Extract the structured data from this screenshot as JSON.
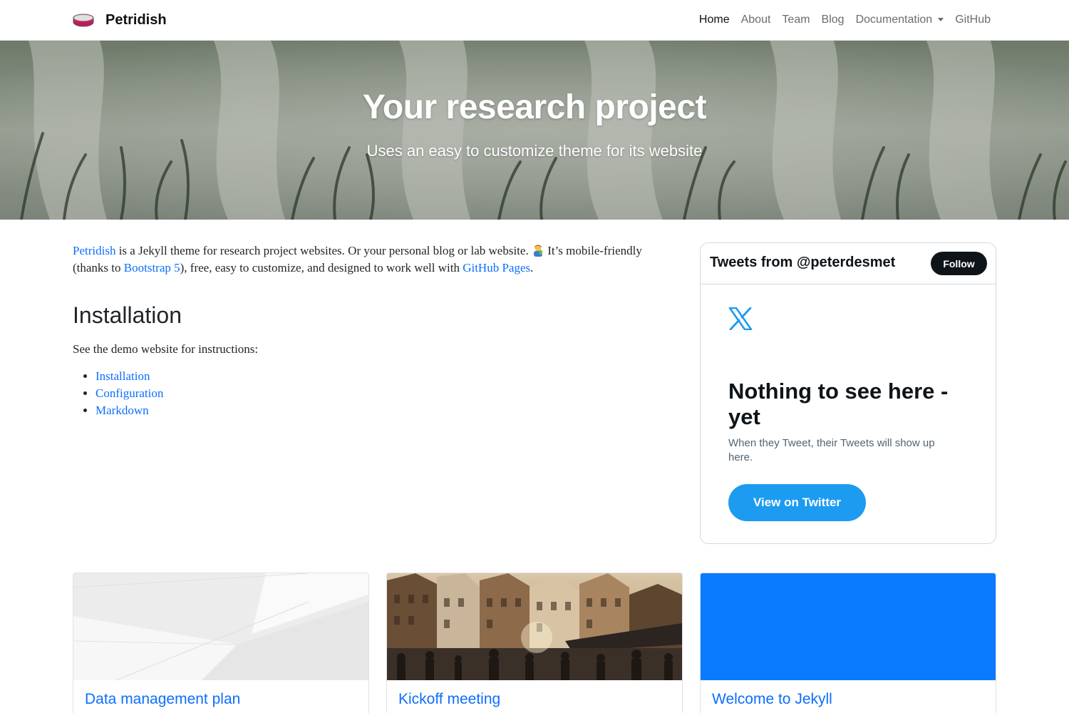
{
  "navbar": {
    "brand": "Petridish",
    "links": [
      {
        "label": "Home",
        "active": true
      },
      {
        "label": "About"
      },
      {
        "label": "Team"
      },
      {
        "label": "Blog"
      },
      {
        "label": "Documentation",
        "dropdown": true
      },
      {
        "label": "GitHub"
      }
    ]
  },
  "hero": {
    "title": "Your research project",
    "subtitle": "Uses an easy to customize theme for its website"
  },
  "intro": {
    "link_petridish": "Petridish",
    "text_1": " is a Jekyll theme for research project websites. Or your personal blog or lab website. ",
    "emoji_icon": "scientist-emoji-icon",
    "text_2": " It’s mobile-friendly (thanks to ",
    "link_bootstrap": "Bootstrap 5",
    "text_3": "), free, easy to customize, and designed to work well with ",
    "link_github_pages": "GitHub Pages",
    "text_4": "."
  },
  "installation": {
    "heading": "Installation",
    "text": "See the demo website for instructions:",
    "links": [
      "Installation",
      "Configuration",
      "Markdown"
    ]
  },
  "twitter": {
    "header": "Tweets from @peterdesmet",
    "follow_label": "Follow",
    "empty_title": "Nothing to see here - yet",
    "empty_text": "When they Tweet, their Tweets will show up here.",
    "view_button": "View on Twitter"
  },
  "cards": [
    {
      "title": "Data management plan",
      "image": "white-architecture-photo"
    },
    {
      "title": "Kickoff meeting",
      "image": "city-square-crowd-photo"
    },
    {
      "title": "Welcome to Jekyll",
      "image": "solid-blue-placeholder",
      "color": "#0a7bff"
    }
  ],
  "colors": {
    "link": "#0d6efd",
    "twitter_blue": "#1d9bf0",
    "card_blue": "#0a7bff"
  }
}
